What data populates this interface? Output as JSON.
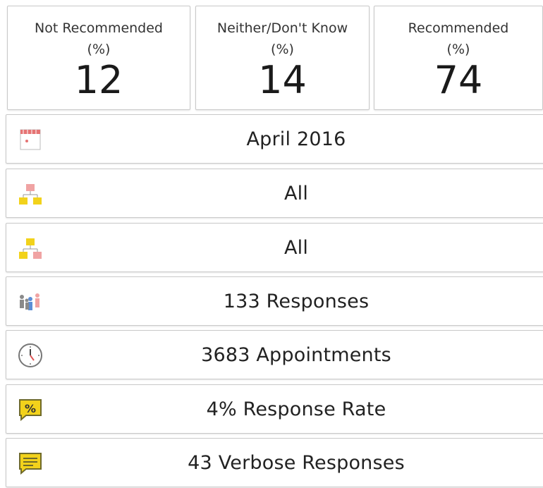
{
  "summary_tiles": [
    {
      "label_line1": "Not Recommended",
      "label_line2": "(%)",
      "value": "12"
    },
    {
      "label_line1": "Neither/Don't Know",
      "label_line2": "(%)",
      "value": "14"
    },
    {
      "label_line1": "Recommended",
      "label_line2": "(%)",
      "value": "74"
    }
  ],
  "info_rows": [
    {
      "icon": "calendar-icon",
      "text": "April 2016"
    },
    {
      "icon": "org-chart-icon",
      "text": "All"
    },
    {
      "icon": "org-chart-alt-icon",
      "text": "All"
    },
    {
      "icon": "people-icon",
      "text": "133 Responses"
    },
    {
      "icon": "clock-icon",
      "text": "3683 Appointments"
    },
    {
      "icon": "percent-chat-icon",
      "text": "4% Response Rate"
    },
    {
      "icon": "comments-icon",
      "text": "43 Verbose Responses"
    }
  ],
  "colors": {
    "red": "#e57373",
    "pink": "#f0a3a3",
    "yellow": "#f2d21b",
    "grey": "#8a8a8a",
    "blue": "#5b8ed6",
    "olive": "#6f6a2a"
  }
}
